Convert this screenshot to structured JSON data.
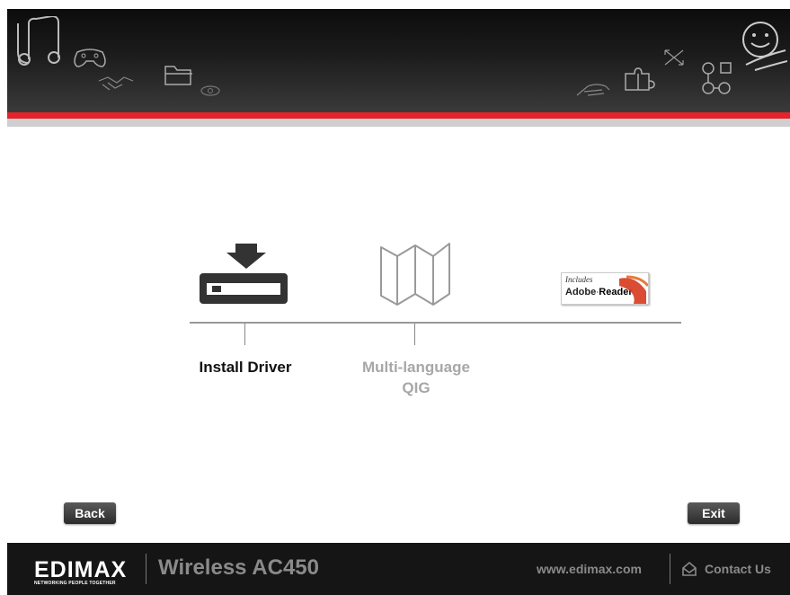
{
  "header": {
    "decor_icons": [
      "music-note-icon",
      "gamepad-icon",
      "handshake-icon",
      "folder-icon",
      "eye-icon",
      "hand-icon",
      "puzzle-icon",
      "arrows-icon",
      "network-nodes-icon",
      "smiley-icon"
    ]
  },
  "options": [
    {
      "label": "Install Driver",
      "state": "active",
      "icon": "download-drive-icon"
    },
    {
      "label_line1": "Multi-language",
      "label_line2": "QIG",
      "state": "disabled",
      "icon": "map-icon"
    },
    {
      "state": "active",
      "icon": "adobe-reader-badge"
    }
  ],
  "adobe_badge": {
    "line1": "Includes",
    "brand": "Adobe",
    "product": "Reader"
  },
  "buttons": {
    "back": "Back",
    "exit": "Exit"
  },
  "footer": {
    "logo": "EDIMAX",
    "tagline": "NETWORKING PEOPLE TOGETHER",
    "product": "Wireless AC450",
    "url": "www.edimax.com",
    "contact": "Contact Us"
  },
  "colors": {
    "accent_red": "#e5232a",
    "header_dark": "#1c1c1c",
    "footer_dark": "#151515",
    "disabled_text": "#a7a7a7"
  }
}
